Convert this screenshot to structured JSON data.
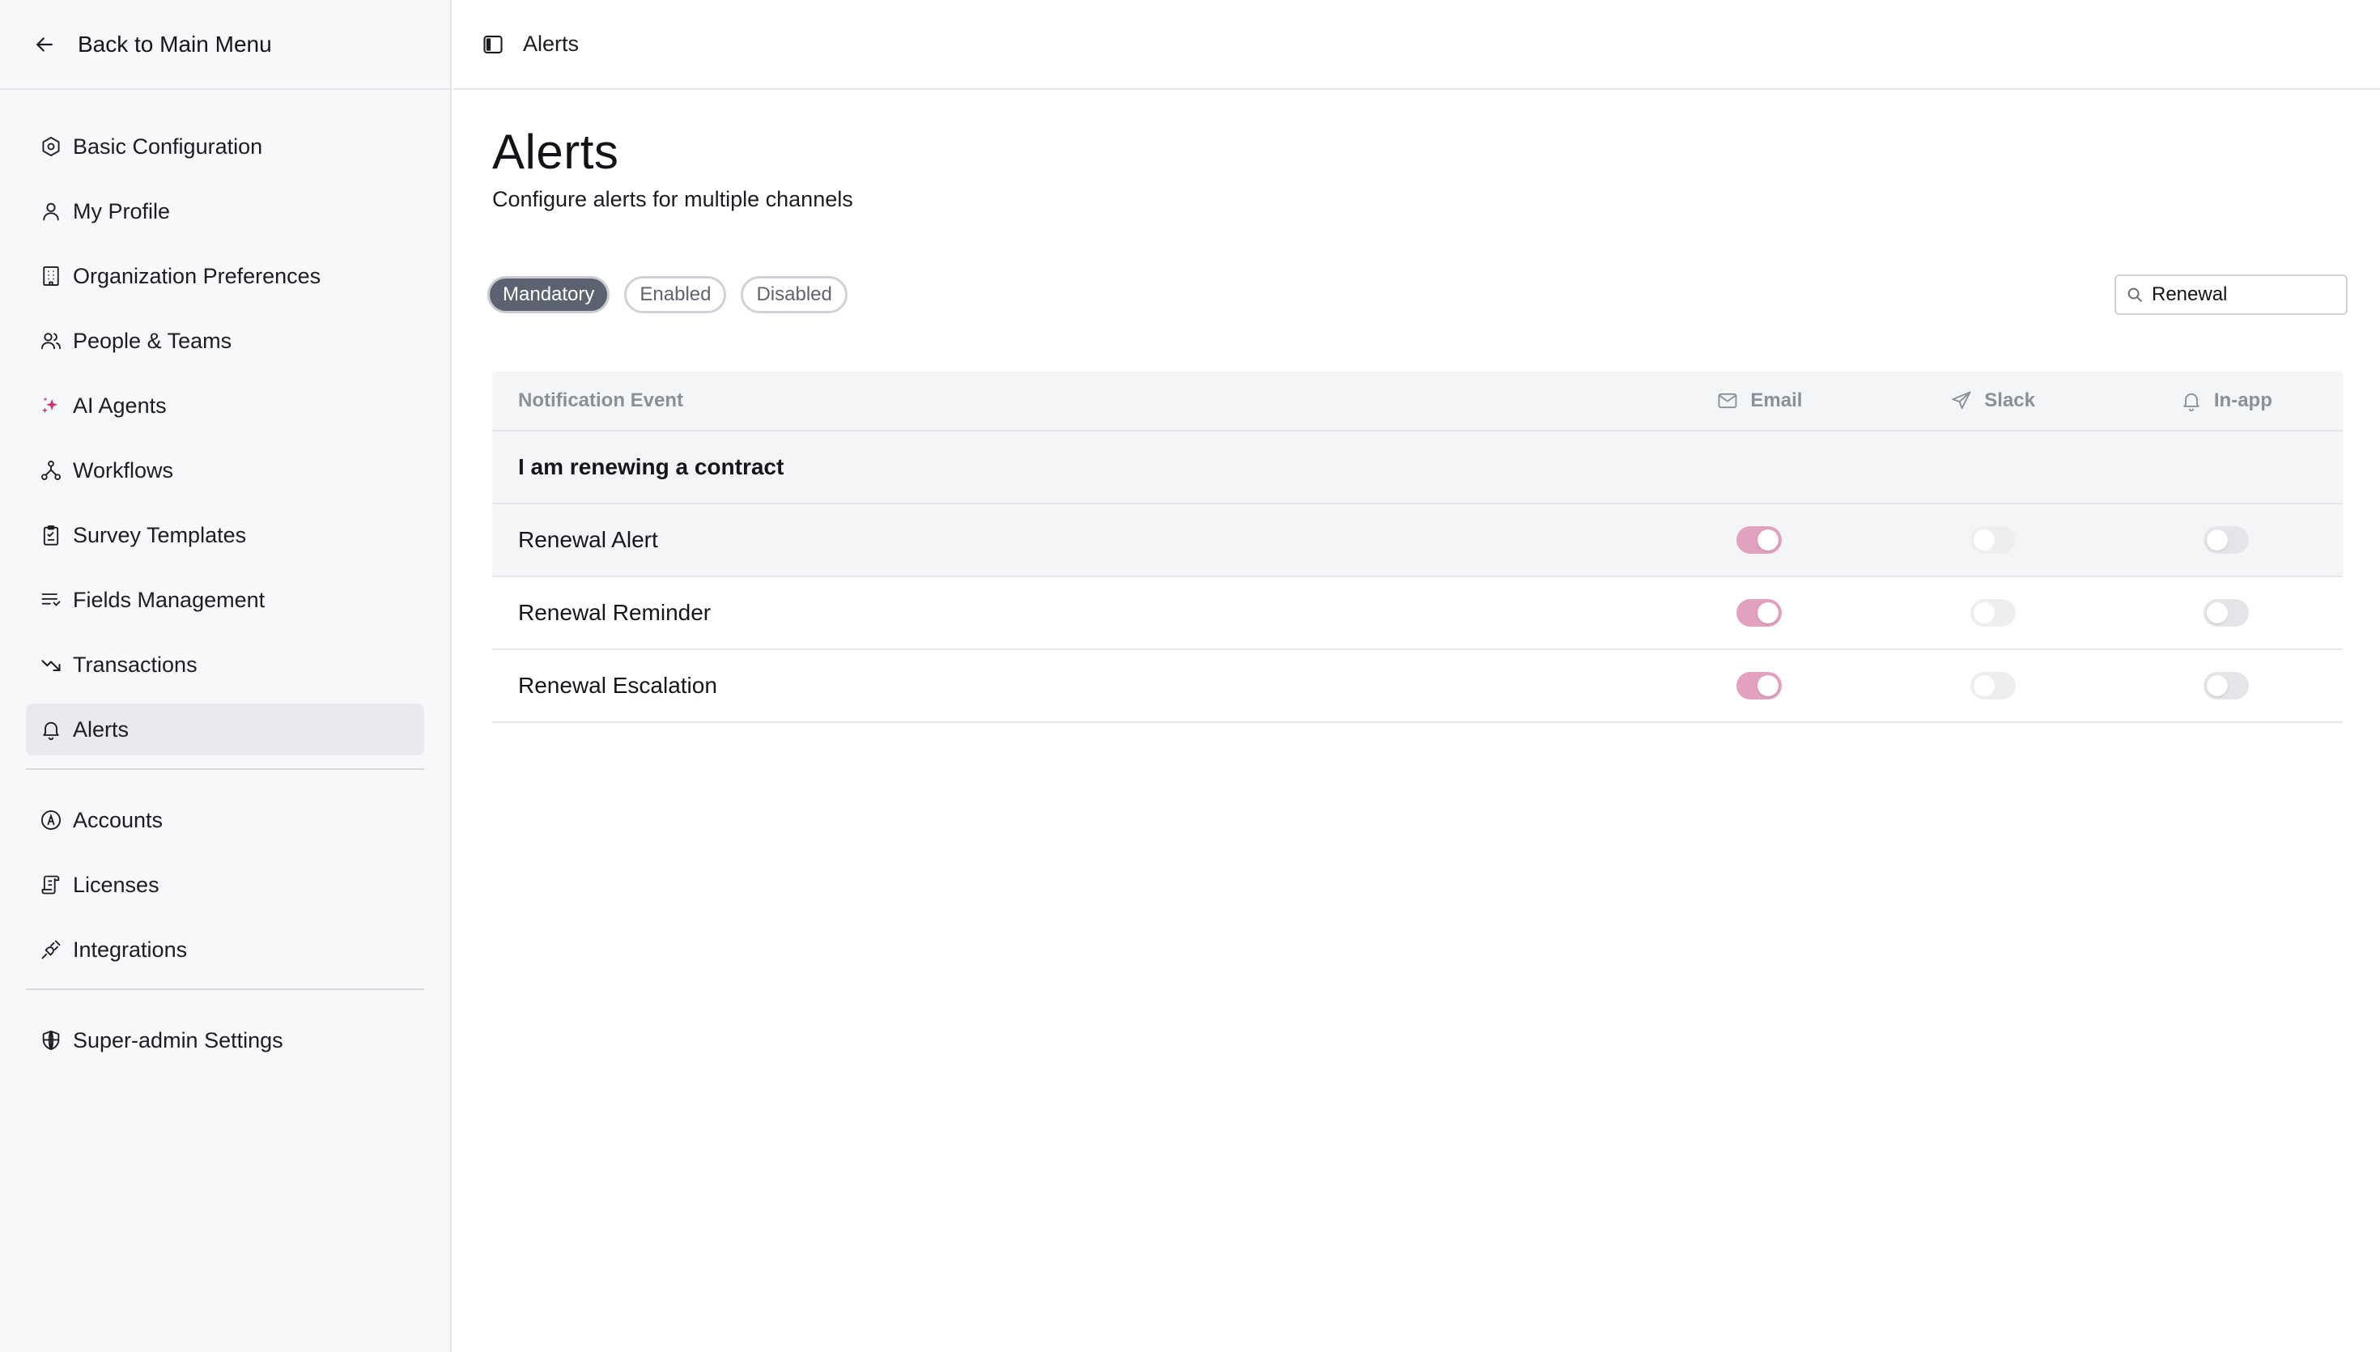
{
  "sidebar": {
    "back_label": "Back to Main Menu",
    "groups": [
      [
        {
          "label": "Basic Configuration",
          "icon": "hexagon-settings-icon"
        },
        {
          "label": "My Profile",
          "icon": "user-icon"
        },
        {
          "label": "Organization Preferences",
          "icon": "building-icon"
        },
        {
          "label": "People & Teams",
          "icon": "users-icon"
        },
        {
          "label": "AI Agents",
          "icon": "sparkles-icon"
        },
        {
          "label": "Workflows",
          "icon": "workflow-icon"
        },
        {
          "label": "Survey Templates",
          "icon": "clipboard-icon"
        },
        {
          "label": "Fields Management",
          "icon": "list-filter-icon"
        },
        {
          "label": "Transactions",
          "icon": "trend-arrow-icon"
        },
        {
          "label": "Alerts",
          "icon": "bell-icon",
          "active": true
        }
      ],
      [
        {
          "label": "Accounts",
          "icon": "circle-a-icon"
        },
        {
          "label": "Licenses",
          "icon": "license-scroll-icon"
        },
        {
          "label": "Integrations",
          "icon": "plug-icon"
        }
      ],
      [
        {
          "label": "Super-admin Settings",
          "icon": "shield-globe-icon"
        }
      ]
    ]
  },
  "topbar": {
    "breadcrumb": "Alerts"
  },
  "page": {
    "title": "Alerts",
    "subtitle": "Configure alerts for multiple channels"
  },
  "filters": {
    "mandatory": "Mandatory",
    "enabled": "Enabled",
    "disabled": "Disabled",
    "active": "Mandatory"
  },
  "search": {
    "value": "Renewal"
  },
  "table": {
    "headers": {
      "event": "Notification Event",
      "email": "Email",
      "slack": "Slack",
      "inapp": "In-app"
    },
    "group_label": "I am renewing a contract",
    "rows": [
      {
        "event": "Renewal Alert",
        "email": true,
        "slack": false,
        "inapp": false
      },
      {
        "event": "Renewal Reminder",
        "email": true,
        "slack": false,
        "inapp": false
      },
      {
        "event": "Renewal Escalation",
        "email": true,
        "slack": false,
        "inapp": false
      }
    ]
  },
  "colors": {
    "toggle_on": "#e2a1bf",
    "toggle_off": "#e3e5e8",
    "chip_active": "#5b6270",
    "active_nav_bg": "#e9eaed"
  }
}
